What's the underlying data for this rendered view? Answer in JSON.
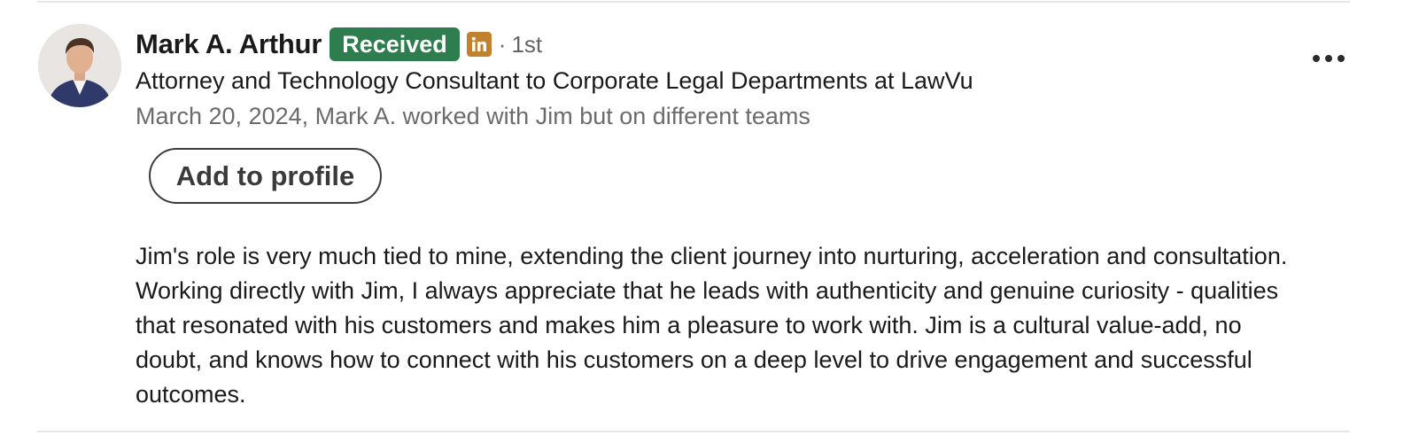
{
  "recommender": {
    "name": "Mark A. Arthur",
    "badge": "Received",
    "connection_separator": "·",
    "connection_degree": "1st",
    "headline": "Attorney and Technology Consultant to Corporate Legal Departments at LawVu",
    "meta": "March 20, 2024, Mark A. worked with Jim but on different teams"
  },
  "actions": {
    "add_to_profile_label": "Add to profile",
    "more_icon": "ellipsis-horizontal-icon"
  },
  "recommendation": {
    "text": "Jim's role is very much tied to mine, extending the client journey into nurturing, acceleration and consultation. Working directly with Jim, I always appreciate that he leads with authenticity and genuine curiosity - qualities that resonated with his customers and makes him a pleasure to work with. Jim is a cultural value-add, no doubt, and knows how to connect with his customers on a deep level to drive engagement and successful outcomes."
  },
  "icons": {
    "linkedin": "linkedin-icon",
    "avatar": "profile-photo"
  },
  "colors": {
    "badge_bg": "#2e7d4f",
    "linkedin_icon_bg": "#c1812e",
    "muted_text": "#6b6b6b"
  }
}
